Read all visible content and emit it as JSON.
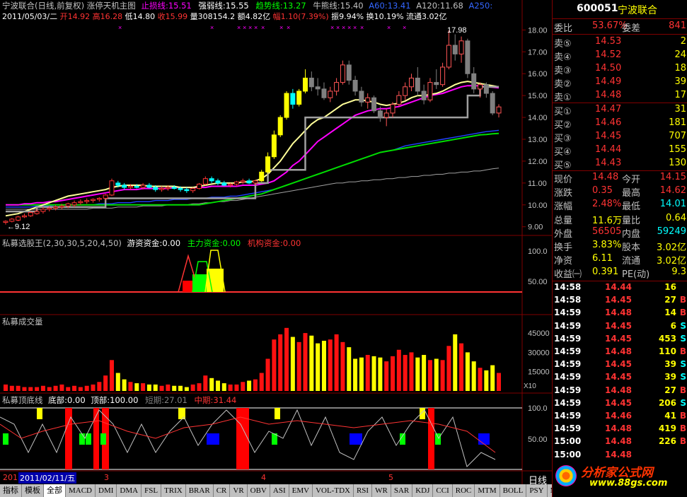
{
  "colors": {
    "up": "#ff3333",
    "down": "#00ffff",
    "yellow": "#ffff00",
    "green": "#00ff00",
    "white": "#ffffff",
    "grid": "#800000",
    "magenta": "#ff00ff",
    "gray": "#808080",
    "blue": "#3366ff"
  },
  "header": {
    "title": "宁波联合(日线,前复权) 涨停天机主图",
    "stop_line": "止损线:15.51",
    "strong_line": "强弱线:15.55",
    "trend_line": "趋势线:13.27",
    "bull_line": "牛熊线:15.40",
    "a60": "A60:13.41",
    "a120": "A120:11.68",
    "a250": "A250:",
    "date": "2011/05/03/二",
    "open": "开14.92",
    "high": "高16.28",
    "low": "低14.80",
    "close": "收15.99",
    "vol": "量308154.2",
    "amount": "额4.82亿",
    "change": "幅1.10(7.39%)",
    "amplitude": "振9.94%",
    "turnover": "换10.19%",
    "float": "流通3.02亿"
  },
  "price_axis": [
    "18.00",
    "17.00",
    "16.00",
    "15.00",
    "14.00",
    "13.00",
    "12.00",
    "11.00",
    "10.00",
    "9.00"
  ],
  "price_marks": {
    "high": "17.98",
    "low": "9.12"
  },
  "panel2": {
    "title": "私募选股王(2,30,30,5,20,4,50)",
    "a": "游资资金:0.00",
    "b": "主力资金:0.00",
    "c": "机构资金:0.00",
    "axis": [
      "100.0",
      "50.00"
    ]
  },
  "panel3": {
    "title": "私募成交量",
    "axis": [
      "45000",
      "30000",
      "15000"
    ],
    "unit": "X10"
  },
  "panel4": {
    "title": "私募顶底线",
    "bottom": "底部:0.00",
    "top": "顶部:100.00",
    "short": "短期:27.01",
    "mid": "中期:31.44",
    "axis": [
      "100.0",
      "50.00"
    ]
  },
  "date_axis": {
    "cursor": "2011/02/11/五",
    "m3": "3",
    "m4": "4",
    "m5": "5",
    "prefix": "201"
  },
  "tabs": [
    "指标",
    "模板",
    "全部",
    "MACD",
    "DMI",
    "DMA",
    "FSL",
    "TRIX",
    "BRAR",
    "CR",
    "VR",
    "OBV",
    "ASI",
    "EMV",
    "VOL-TDX",
    "RSI",
    "WR",
    "SAR",
    "KDJ",
    "CCI",
    "ROC",
    "MTM",
    "BOLL",
    "PSY",
    "MCST"
  ],
  "right": {
    "code": "600051",
    "name": "宁波联合",
    "wb_label": "委比",
    "wb": "53.67%",
    "wc_label": "委差",
    "wc": "841",
    "asks": [
      {
        "l": "卖⑤",
        "p": "14.53",
        "v": "2"
      },
      {
        "l": "卖④",
        "p": "14.52",
        "v": "24"
      },
      {
        "l": "卖③",
        "p": "14.50",
        "v": "18"
      },
      {
        "l": "卖②",
        "p": "14.49",
        "v": "39"
      },
      {
        "l": "卖①",
        "p": "14.48",
        "v": "17"
      }
    ],
    "bids": [
      {
        "l": "买①",
        "p": "14.47",
        "v": "31"
      },
      {
        "l": "买②",
        "p": "14.46",
        "v": "181"
      },
      {
        "l": "买③",
        "p": "14.45",
        "v": "707"
      },
      {
        "l": "买④",
        "p": "14.44",
        "v": "155"
      },
      {
        "l": "买⑤",
        "p": "14.43",
        "v": "130"
      }
    ],
    "quote": [
      {
        "l1": "现价",
        "v1": "14.48",
        "l2": "今开",
        "v2": "14.15",
        "c1": "#ff3333",
        "c2": "#ff3333"
      },
      {
        "l1": "涨跌",
        "v1": "0.35",
        "l2": "最高",
        "v2": "14.62",
        "c1": "#ff3333",
        "c2": "#ff3333"
      },
      {
        "l1": "涨幅",
        "v1": "2.48%",
        "l2": "最低",
        "v2": "14.01",
        "c1": "#ff3333",
        "c2": "#00ffff"
      },
      {
        "l1": "总量",
        "v1": "11.6万",
        "l2": "量比",
        "v2": "0.64",
        "c1": "#ffff00",
        "c2": "#ffff00"
      },
      {
        "l1": "外盘",
        "v1": "56505",
        "l2": "内盘",
        "v2": "59249",
        "c1": "#ff3333",
        "c2": "#00ffff"
      },
      {
        "l1": "换手",
        "v1": "3.83%",
        "l2": "股本",
        "v2": "3.02亿",
        "c1": "#ffff00",
        "c2": "#ffff00"
      },
      {
        "l1": "净资",
        "v1": "6.11",
        "l2": "流通",
        "v2": "3.02亿",
        "c1": "#ffff00",
        "c2": "#ffff00"
      },
      {
        "l1": "收益㈠",
        "v1": "0.391",
        "l2": "PE(动)",
        "v2": "9.3",
        "c1": "#ffff00",
        "c2": "#ffff00"
      }
    ],
    "ticks": [
      {
        "t": "14:58",
        "p": "14.44",
        "v": "16",
        "s": ""
      },
      {
        "t": "14:58",
        "p": "14.45",
        "v": "27",
        "s": "B"
      },
      {
        "t": "14:59",
        "p": "14.48",
        "v": "14",
        "s": "B"
      },
      {
        "t": "14:59",
        "p": "14.45",
        "v": "6",
        "s": "S"
      },
      {
        "t": "14:59",
        "p": "14.45",
        "v": "453",
        "s": "S"
      },
      {
        "t": "14:59",
        "p": "14.48",
        "v": "110",
        "s": "B"
      },
      {
        "t": "14:59",
        "p": "14.45",
        "v": "39",
        "s": "S"
      },
      {
        "t": "14:59",
        "p": "14.45",
        "v": "39",
        "s": "S"
      },
      {
        "t": "14:59",
        "p": "14.48",
        "v": "27",
        "s": "B"
      },
      {
        "t": "14:59",
        "p": "14.45",
        "v": "206",
        "s": "S"
      },
      {
        "t": "14:59",
        "p": "14.46",
        "v": "41",
        "s": "B"
      },
      {
        "t": "14:59",
        "p": "14.48",
        "v": "419",
        "s": "B"
      },
      {
        "t": "15:00",
        "p": "14.48",
        "v": "226",
        "s": "B"
      },
      {
        "t": "15:00",
        "p": "14.48",
        "v": "",
        "s": ""
      }
    ],
    "bottom_label": "日线",
    "watermark": "分析家公式网",
    "watermark_url": "www.88gs.com"
  },
  "chart_data": {
    "type": "candlestick",
    "ylim": [
      8.7,
      18.4
    ],
    "candles": [
      [
        9.2,
        9.3,
        9.1,
        9.25
      ],
      [
        9.25,
        9.4,
        9.2,
        9.35
      ],
      [
        9.3,
        9.5,
        9.25,
        9.45
      ],
      [
        9.45,
        9.6,
        9.4,
        9.5
      ],
      [
        9.5,
        9.7,
        9.45,
        9.65
      ],
      [
        9.6,
        9.8,
        9.55,
        9.7
      ],
      [
        9.7,
        9.9,
        9.6,
        9.8
      ],
      [
        9.8,
        9.95,
        9.7,
        9.85
      ],
      [
        9.85,
        10.0,
        9.75,
        9.9
      ],
      [
        9.9,
        10.05,
        9.8,
        9.95
      ],
      [
        9.95,
        10.1,
        9.85,
        10.05
      ],
      [
        10.0,
        10.2,
        9.9,
        10.1
      ],
      [
        10.1,
        10.25,
        10.0,
        10.15
      ],
      [
        10.15,
        10.3,
        10.05,
        10.2
      ],
      [
        10.2,
        10.3,
        10.1,
        10.25
      ],
      [
        10.25,
        10.35,
        10.15,
        10.3
      ],
      [
        10.3,
        10.5,
        10.2,
        10.45
      ],
      [
        10.45,
        11.2,
        10.4,
        11.1
      ],
      [
        11.0,
        11.1,
        10.8,
        10.9
      ],
      [
        10.9,
        11.0,
        10.7,
        10.8
      ],
      [
        10.8,
        10.95,
        10.7,
        10.85
      ],
      [
        10.85,
        10.95,
        10.75,
        10.8
      ],
      [
        10.8,
        11.0,
        10.7,
        10.9
      ],
      [
        10.9,
        11.0,
        10.75,
        10.8
      ],
      [
        10.8,
        10.9,
        10.6,
        10.7
      ],
      [
        10.7,
        10.85,
        10.6,
        10.75
      ],
      [
        10.75,
        10.9,
        10.65,
        10.8
      ],
      [
        10.8,
        10.9,
        10.7,
        10.75
      ],
      [
        10.75,
        10.85,
        10.6,
        10.7
      ],
      [
        10.7,
        10.8,
        10.55,
        10.65
      ],
      [
        10.65,
        10.8,
        10.55,
        10.75
      ],
      [
        10.75,
        11.0,
        10.7,
        10.95
      ],
      [
        10.95,
        11.3,
        10.9,
        11.2
      ],
      [
        11.2,
        11.3,
        11.0,
        11.1
      ],
      [
        11.1,
        11.2,
        10.9,
        11.0
      ],
      [
        11.0,
        11.1,
        10.85,
        10.9
      ],
      [
        10.9,
        11.0,
        10.8,
        10.95
      ],
      [
        10.95,
        11.1,
        10.85,
        11.05
      ],
      [
        11.05,
        11.2,
        10.95,
        11.1
      ],
      [
        11.1,
        11.2,
        10.95,
        11.0
      ],
      [
        11.0,
        11.15,
        10.9,
        11.1
      ],
      [
        11.1,
        11.6,
        11.05,
        11.5
      ],
      [
        11.5,
        12.4,
        11.4,
        12.2
      ],
      [
        12.2,
        13.4,
        12.1,
        13.2
      ],
      [
        13.2,
        14.1,
        13.1,
        14.0
      ],
      [
        14.0,
        15.2,
        13.9,
        15.1
      ],
      [
        15.1,
        15.3,
        14.4,
        14.6
      ],
      [
        14.6,
        15.3,
        14.5,
        15.2
      ],
      [
        15.2,
        16.2,
        15.1,
        15.8
      ],
      [
        15.8,
        16.1,
        15.2,
        15.4
      ],
      [
        15.4,
        15.8,
        15.0,
        15.3
      ],
      [
        15.3,
        15.6,
        14.8,
        14.9
      ],
      [
        14.9,
        15.4,
        14.7,
        15.2
      ],
      [
        15.2,
        15.8,
        15.0,
        15.6
      ],
      [
        15.6,
        16.6,
        15.5,
        16.4
      ],
      [
        16.4,
        16.6,
        15.5,
        15.7
      ],
      [
        15.7,
        15.9,
        15.0,
        15.2
      ],
      [
        15.2,
        15.4,
        14.5,
        14.7
      ],
      [
        14.7,
        15.1,
        14.4,
        14.9
      ],
      [
        14.9,
        15.0,
        14.2,
        14.3
      ],
      [
        14.3,
        14.5,
        13.8,
        14.0
      ],
      [
        14.0,
        14.4,
        13.6,
        14.2
      ],
      [
        14.2,
        14.7,
        14.0,
        14.6
      ],
      [
        14.6,
        15.2,
        14.5,
        15.0
      ],
      [
        15.0,
        15.6,
        14.8,
        15.4
      ],
      [
        15.4,
        16.0,
        15.2,
        15.8
      ],
      [
        15.8,
        16.3,
        15.0,
        15.2
      ],
      [
        15.2,
        15.5,
        14.6,
        14.8
      ],
      [
        14.8,
        15.8,
        14.7,
        15.6
      ],
      [
        15.6,
        16.2,
        15.3,
        15.5
      ],
      [
        15.5,
        16.5,
        15.4,
        16.3
      ],
      [
        16.3,
        17.98,
        16.2,
        17.3
      ],
      [
        17.3,
        17.8,
        16.6,
        16.9
      ],
      [
        16.9,
        17.7,
        16.5,
        17.5
      ],
      [
        17.5,
        17.6,
        15.8,
        16.0
      ],
      [
        16.0,
        16.3,
        15.1,
        15.3
      ],
      [
        15.3,
        15.6,
        14.9,
        15.5
      ],
      [
        15.5,
        15.6,
        14.9,
        15.1
      ],
      [
        15.1,
        15.2,
        14.1,
        14.2
      ],
      [
        14.2,
        14.6,
        14.0,
        14.48
      ]
    ],
    "ma_white": [
      9.5,
      9.55,
      9.6,
      9.7,
      9.8,
      9.9,
      10.0,
      10.1,
      10.2,
      10.3,
      10.4,
      10.45,
      10.5,
      10.55,
      10.6,
      10.65,
      10.7,
      10.8,
      10.85,
      10.9,
      10.9,
      10.9,
      10.9,
      10.85,
      10.85,
      10.85,
      10.85,
      10.85,
      10.8,
      10.8,
      10.8,
      10.85,
      10.9,
      10.95,
      11.0,
      11.0,
      11.0,
      11.0,
      11.05,
      11.05,
      11.1,
      11.2,
      11.4,
      11.7,
      12.0,
      12.4,
      12.8,
      13.1,
      13.4,
      13.7,
      13.9,
      14.0,
      14.2,
      14.4,
      14.6,
      14.7,
      14.8,
      14.8,
      14.75,
      14.7,
      14.6,
      14.55,
      14.6,
      14.65,
      14.75,
      14.9,
      15.0,
      15.0,
      15.05,
      15.1,
      15.2,
      15.35,
      15.5,
      15.6,
      15.65,
      15.6,
      15.55,
      15.5,
      15.45,
      15.4
    ],
    "ma_magenta": [
      10.0,
      10.0,
      10.0,
      10.05,
      10.05,
      10.1,
      10.1,
      10.15,
      10.15,
      10.2,
      10.25,
      10.3,
      10.35,
      10.4,
      10.45,
      10.5,
      10.55,
      10.6,
      10.65,
      10.7,
      10.7,
      10.7,
      10.75,
      10.75,
      10.75,
      10.75,
      10.75,
      10.8,
      10.8,
      10.8,
      10.8,
      10.8,
      10.8,
      10.85,
      10.85,
      10.85,
      10.85,
      10.85,
      10.9,
      10.9,
      10.9,
      10.95,
      11.0,
      11.1,
      11.3,
      11.5,
      11.8,
      12.0,
      12.3,
      12.6,
      12.9,
      13.1,
      13.3,
      13.5,
      13.7,
      13.9,
      14.1,
      14.2,
      14.3,
      14.35,
      14.4,
      14.4,
      14.45,
      14.5,
      14.6,
      14.7,
      14.8,
      14.9,
      15.0,
      15.05,
      15.1,
      15.2,
      15.3,
      15.4,
      15.45,
      15.45,
      15.45,
      15.4,
      15.38,
      15.35
    ],
    "ma_green": [
      10.0,
      10.0,
      10.0,
      10.0,
      10.0,
      10.0,
      10.0,
      10.0,
      10.0,
      10.0,
      10.0,
      10.0,
      10.0,
      10.0,
      10.0,
      10.0,
      10.0,
      10.0,
      10.0,
      10.0,
      10.0,
      10.0,
      10.0,
      10.0,
      10.0,
      10.0,
      10.0,
      10.0,
      10.0,
      10.0,
      10.0,
      10.0,
      10.05,
      10.1,
      10.15,
      10.2,
      10.25,
      10.3,
      10.35,
      10.4,
      10.45,
      10.5,
      10.6,
      10.7,
      10.8,
      10.9,
      11.0,
      11.1,
      11.2,
      11.3,
      11.4,
      11.5,
      11.6,
      11.7,
      11.8,
      11.9,
      12.0,
      12.1,
      12.2,
      12.3,
      12.4,
      12.45,
      12.5,
      12.55,
      12.6,
      12.65,
      12.7,
      12.75,
      12.8,
      12.85,
      12.9,
      12.95,
      13.0,
      13.05,
      13.1,
      13.15,
      13.2,
      13.22,
      13.25,
      13.27
    ],
    "ma_gray": [
      9.8,
      9.8,
      9.8,
      9.8,
      9.8,
      9.8,
      9.8,
      9.8,
      9.8,
      9.8,
      9.8,
      9.8,
      9.8,
      9.8,
      9.85,
      9.85,
      9.85,
      9.85,
      9.9,
      9.9,
      9.9,
      9.9,
      9.95,
      9.95,
      9.95,
      9.95,
      10.0,
      10.0,
      10.0,
      10.0,
      10.05,
      10.05,
      10.1,
      10.1,
      10.15,
      10.15,
      10.2,
      10.2,
      10.25,
      10.3,
      10.35,
      10.4,
      10.45,
      10.5,
      10.55,
      10.6,
      10.65,
      10.7,
      10.75,
      10.8,
      10.85,
      10.9,
      10.95,
      11.0,
      11.0,
      11.05,
      11.05,
      11.1,
      11.1,
      11.15,
      11.15,
      11.2,
      11.2,
      11.25,
      11.25,
      11.3,
      11.3,
      11.35,
      11.35,
      11.4,
      11.4,
      11.45,
      11.45,
      11.5,
      11.5,
      11.55,
      11.55,
      11.6,
      11.65,
      11.68
    ],
    "ma_blue": [
      9.9,
      9.9,
      9.9,
      9.9,
      9.9,
      9.95,
      9.95,
      9.95,
      10.0,
      10.0,
      10.0,
      10.0,
      10.0,
      10.0,
      10.0,
      10.05,
      10.05,
      10.05,
      10.1,
      10.1,
      10.1,
      10.15,
      10.15,
      10.15,
      10.2,
      10.2,
      10.2,
      10.25,
      10.25,
      10.25,
      10.3,
      10.3,
      10.3,
      10.35,
      10.35,
      10.35,
      10.4,
      10.4,
      10.45,
      10.5,
      10.55,
      10.6,
      10.65,
      10.7,
      10.8,
      10.9,
      11.0,
      11.1,
      11.2,
      11.3,
      11.4,
      11.5,
      11.6,
      11.7,
      11.8,
      11.9,
      12.0,
      12.1,
      12.2,
      12.3,
      12.4,
      12.45,
      12.5,
      12.6,
      12.7,
      12.75,
      12.8,
      12.85,
      12.9,
      12.95,
      13.0,
      13.05,
      13.1,
      13.15,
      13.2,
      13.25,
      13.3,
      13.35,
      13.38,
      13.41
    ],
    "stepline": [
      9.7,
      9.7,
      9.7,
      9.7,
      9.7,
      9.9,
      9.9,
      9.9,
      9.9,
      9.9,
      9.9,
      9.9,
      9.9,
      9.9,
      9.9,
      9.9,
      10.3,
      10.3,
      10.3,
      10.3,
      10.3,
      10.3,
      10.3,
      10.3,
      10.3,
      10.3,
      10.3,
      10.3,
      10.3,
      10.3,
      10.3,
      10.3,
      10.3,
      10.3,
      10.3,
      10.3,
      10.3,
      10.3,
      10.3,
      10.3,
      11.0,
      11.0,
      11.6,
      11.6,
      11.6,
      11.6,
      11.6,
      11.6,
      14.0,
      14.0,
      14.0,
      14.0,
      14.0,
      14.0,
      14.0,
      14.0,
      14.0,
      14.0,
      14.0,
      14.0,
      14.0,
      14.0,
      14.0,
      14.0,
      14.0,
      14.0,
      14.0,
      14.0,
      14.0,
      14.0,
      14.0,
      14.0,
      14.0,
      14.0,
      15.0,
      15.0,
      15.4,
      15.4,
      15.4,
      15.4
    ],
    "volume": [
      5,
      4,
      4,
      3,
      3,
      3,
      4,
      3,
      4,
      5,
      3,
      4,
      3,
      4,
      5,
      7,
      12,
      24,
      14,
      9,
      7,
      6,
      6,
      5,
      5,
      4,
      5,
      4,
      4,
      3,
      5,
      6,
      12,
      10,
      8,
      6,
      5,
      5,
      7,
      8,
      9,
      14,
      25,
      40,
      44,
      49,
      42,
      38,
      45,
      43,
      37,
      39,
      40,
      44,
      38,
      34,
      25,
      26,
      28,
      27,
      26,
      23,
      27,
      32,
      28,
      30,
      26,
      28,
      24,
      25,
      24,
      35,
      44,
      37,
      30,
      23,
      18,
      16,
      20,
      14
    ]
  }
}
